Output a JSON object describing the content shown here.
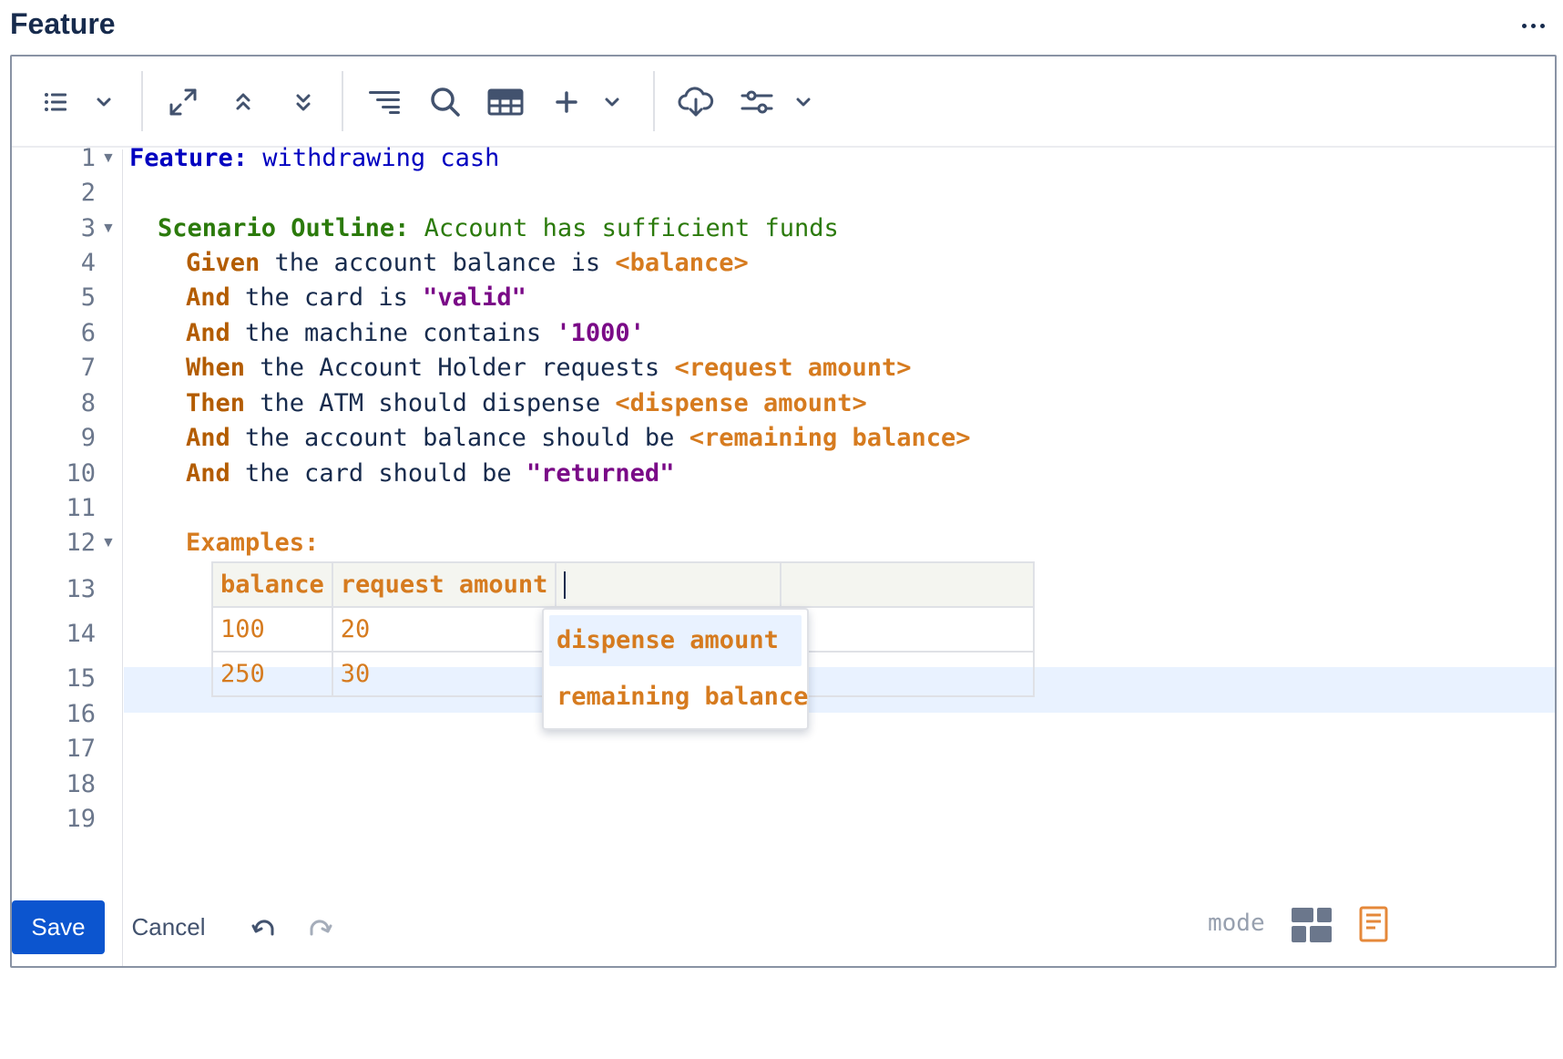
{
  "header": {
    "title": "Feature",
    "more_icon": "more-horizontal-icon"
  },
  "toolbar": {
    "icons": [
      "list-icon",
      "chevron-down-icon",
      "expand-icon",
      "collapse-up-icon",
      "expand-down-icon",
      "indent-icon",
      "search-icon",
      "table-icon",
      "plus-icon",
      "chevron-down-icon",
      "cloud-download-icon",
      "settings-sliders-icon",
      "chevron-down-icon"
    ]
  },
  "editor": {
    "line_numbers": [
      "1",
      "2",
      "3",
      "4",
      "5",
      "6",
      "7",
      "8",
      "9",
      "10",
      "11",
      "12",
      "13",
      "14",
      "15",
      "16",
      "17",
      "18",
      "19"
    ],
    "fold_marker": "▼",
    "lines": {
      "l1": {
        "keyword": "Feature:",
        "text": " withdrawing cash"
      },
      "l3": {
        "keyword": "Scenario Outline:",
        "text": " Account has sufficient funds"
      },
      "l4": {
        "keyword": "Given",
        "text": " the account balance is ",
        "param": "<balance>"
      },
      "l5": {
        "keyword": "And",
        "text": " the card is ",
        "string": "\"valid\""
      },
      "l6": {
        "keyword": "And",
        "text": " the machine contains ",
        "string": "'1000'"
      },
      "l7": {
        "keyword": "When",
        "text": " the Account Holder requests ",
        "param": "<request amount>"
      },
      "l8": {
        "keyword": "Then",
        "text": " the ATM should dispense ",
        "param": "<dispense amount>"
      },
      "l9": {
        "keyword": "And",
        "text": " the account balance should be ",
        "param": "<remaining balance>"
      },
      "l10": {
        "keyword": "And",
        "text": " the card should be ",
        "string": "\"returned\""
      },
      "l12": {
        "keyword": "Examples:"
      }
    },
    "examples_table": {
      "headers": [
        "balance",
        "request amount",
        "",
        ""
      ],
      "rows": [
        [
          "100",
          "20",
          "",
          ""
        ],
        [
          "250",
          "30",
          "",
          ""
        ]
      ]
    },
    "autocomplete": {
      "options": [
        "dispense amount",
        "remaining balance"
      ],
      "selected_index": 0
    },
    "colors": {
      "feature": "#0000c0",
      "scenario": "#2b7a0b",
      "step_keyword": "#b35c00",
      "parameter": "#d67b1f",
      "string": "#7a0a87"
    }
  },
  "footer": {
    "save_label": "Save",
    "cancel_label": "Cancel",
    "mode_label": "mode",
    "icons": [
      "undo-icon",
      "redo-icon",
      "grid-mode-icon",
      "document-mode-icon"
    ]
  }
}
